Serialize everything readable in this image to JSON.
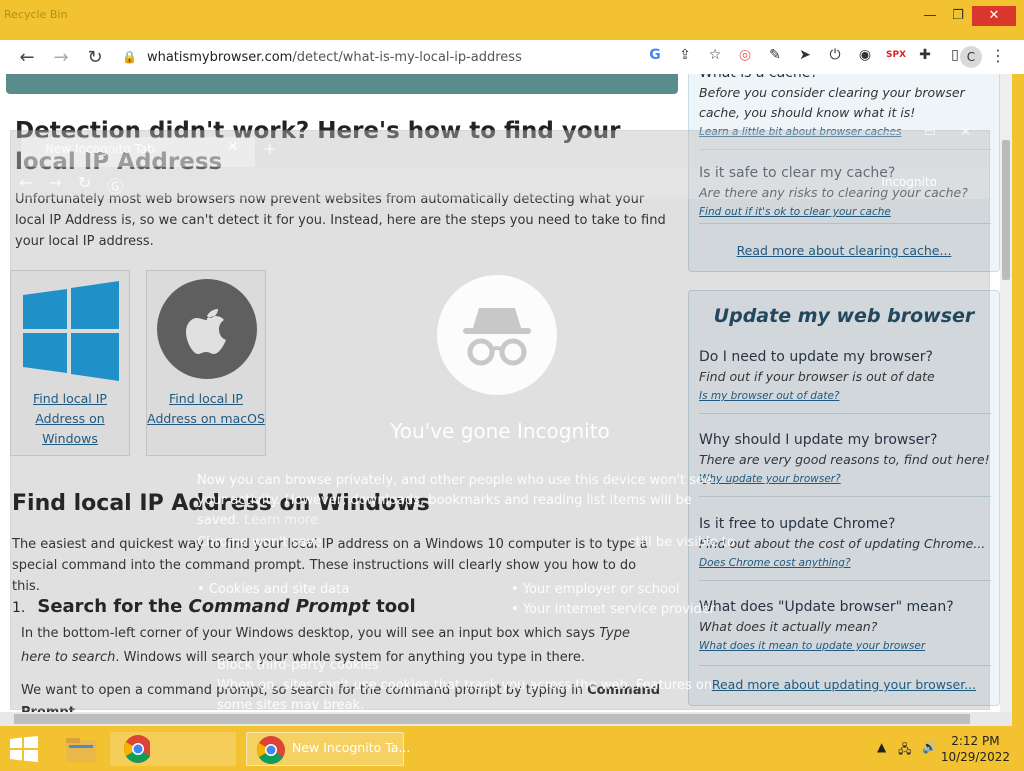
{
  "window": {
    "ghost_tab": "Recycle Bin",
    "minimize": "—",
    "maximize": "❐",
    "close": "✕"
  },
  "omnibox": {
    "url_domain": "whatismybrowser.com",
    "url_path": "/detect/what-is-my-local-ip-address",
    "profile_initial": "C"
  },
  "article": {
    "heading": "Detection didn't work? Here's how to find your local IP Address",
    "intro": "Unfortunately most web browsers now prevent websites from automatically detecting what your local IP Address is, so we can't detect it for you. Instead, here are the steps you need to take to find your local IP address.",
    "cards": [
      {
        "label": "Find local IP Address on Windows"
      },
      {
        "label": "Find local IP Address on macOS"
      }
    ],
    "windows_heading": "Find local IP Address on Windows",
    "windows_intro": "The easiest and quickest way to find your local IP address on a Windows 10 computer is to type a special command into the command prompt. These instructions will clearly show you how to do this.",
    "step_number": "1.",
    "step_title_pre": "Search for the ",
    "step_title_em": "Command Prompt",
    "step_title_post": " tool",
    "step_text_pre": "In the bottom-left corner of your Windows desktop, you will see an input box which says ",
    "step_text_em": "Type here to search",
    "step_text_post": ". Windows will search your whole system for anything you type in there.",
    "step_text2_pre": "We want to open a command prompt, so search for the command prompt by typing in ",
    "step_text2_b": "Command Prompt"
  },
  "sidebar": {
    "cache_items": [
      {
        "q": "What is a cache?",
        "a": "Before you consider clearing your browser cache, you should know what it is!",
        "link": "Learn a little bit about browser caches"
      },
      {
        "q": "Is it safe to clear my cache?",
        "a": "Are there any risks to clearing your cache?",
        "link": "Find out if it's ok to clear your cache"
      }
    ],
    "cache_more": "Read more about clearing cache...",
    "update_title": "Update my web browser",
    "update_items": [
      {
        "q": "Do I need to update my browser?",
        "a": "Find out if your browser is out of date",
        "link": "Is my browser out of date?"
      },
      {
        "q": "Why should I update my browser?",
        "a": "There are very good reasons to, find out here!",
        "link": "Why update your browser?"
      },
      {
        "q": "Is it free to update Chrome?",
        "a": "Find out about the cost of updating Chrome...",
        "link": "Does Chrome cost anything?"
      },
      {
        "q": "What does \"Update browser\" mean?",
        "a": "What does it actually mean?",
        "link": "What does it mean to update your browser"
      }
    ],
    "update_more": "Read more about updating your browser..."
  },
  "incognito": {
    "tab_title": "New Incognito Tab",
    "tab_close": "✕",
    "new_tab": "+",
    "label": "Incognito",
    "heading": "You've gone Incognito",
    "body": "Now you can browse privately, and other people who use this device won't see your activity. However, downloads, bookmarks and reading list items will be saved.",
    "learn_more": "Learn more",
    "visible_note": "still be visible to",
    "wont_save": "Chrome won't save",
    "left_list": [
      "Cookies and site data"
    ],
    "right_list": [
      "Your employer or school",
      "Your internet service provider"
    ],
    "block_title": "Block third-party cookies",
    "block_text": "When on, sites can't use cookies that track you across the web. Features on some sites may break."
  },
  "taskbar": {
    "active_label": "New Incognito Ta...",
    "time": "2:12 PM",
    "date": "10/29/2022"
  },
  "colors": {
    "accent": "#f2c230",
    "link": "#1b5f8c",
    "teal": "#5b8c8c"
  }
}
